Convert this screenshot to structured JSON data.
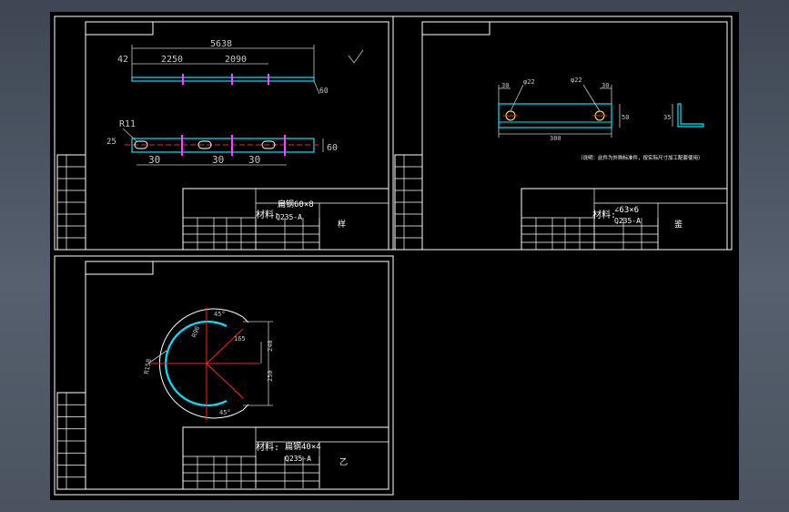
{
  "colors": {
    "background": "#000000",
    "frame": "#ffffff",
    "part": "#00e5ff",
    "dimension": "#c8c8c8",
    "centerline": "#ff2020",
    "tick": "#ff40ff",
    "bolt": "#ffff60"
  },
  "sheet1": {
    "dims": {
      "overall": "5638",
      "left": "42",
      "mid_a": "2250",
      "mid_b": "2090",
      "thickness": "60",
      "radius": "R11",
      "hole_w": "25",
      "slot_a": "30",
      "slot_b": "30",
      "slot_c": "30",
      "height": "60"
    },
    "material_label": "材料:",
    "material_spec": "扁钢60×8",
    "material_std": "Q235-A",
    "stamp": "样"
  },
  "sheet2": {
    "dims": {
      "edge_left": "30",
      "hole_a": "φ22",
      "hole_b": "φ22",
      "edge_right": "30",
      "length": "300",
      "height": "50",
      "angle_size": "35"
    },
    "note": "（说明：此件为外购标准件，按实际尺寸加工配套使用）",
    "material_label": "材料:",
    "material_spec": "∠63×6",
    "material_std": "Q235-A",
    "stamp": "鉴"
  },
  "sheet3": {
    "dims": {
      "angle_top": "45°",
      "inner_r": "R90",
      "outer_r": "R158",
      "offset": "165",
      "upper": "248",
      "lower": "250",
      "angle_bottom": "45°"
    },
    "material_label": "材料:",
    "material_spec": "扁钢40×4",
    "material_std": "Q235-A",
    "stamp": "乙"
  }
}
